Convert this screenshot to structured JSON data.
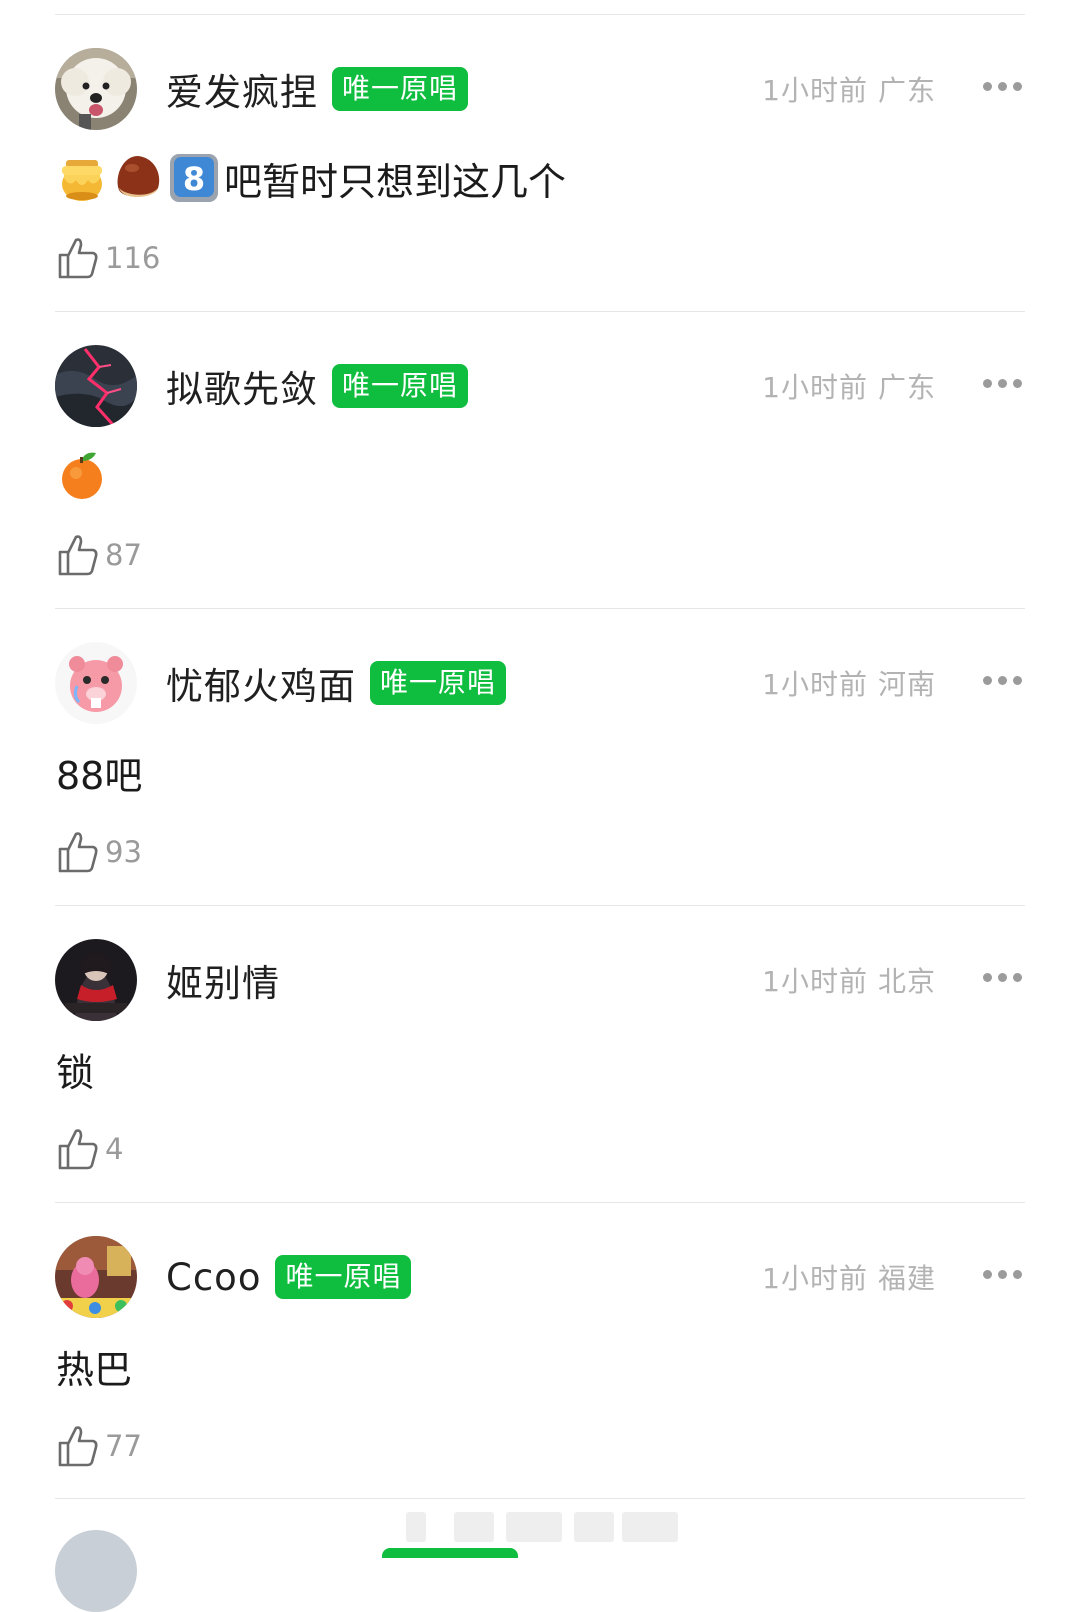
{
  "colors": {
    "badge_bg": "#0fbd3f",
    "meta_text": "#b3b3b3",
    "like_text": "#9a9a9a",
    "divider": "#e6e6e6"
  },
  "comments": [
    {
      "name": "爱发疯捏",
      "badge": "唯一原唱",
      "time": "1小时前",
      "location": "广东",
      "emojis": [
        "honey-pot-emoji",
        "chestnut-emoji",
        "keycap-8-emoji"
      ],
      "text": "吧暂时只想到这几个",
      "likes": "116",
      "avatar": "white-dog-avatar"
    },
    {
      "name": "拟歌先敛",
      "badge": "唯一原唱",
      "time": "1小时前",
      "location": "广东",
      "emojis": [
        "tangerine-emoji"
      ],
      "text": "",
      "likes": "87",
      "avatar": "dark-lightning-avatar"
    },
    {
      "name": "忧郁火鸡面",
      "badge": "唯一原唱",
      "time": "1小时前",
      "location": "河南",
      "emojis": [],
      "text": "88吧",
      "likes": "93",
      "avatar": "pink-beaver-avatar"
    },
    {
      "name": "姬别情",
      "badge": "",
      "time": "1小时前",
      "location": "北京",
      "emojis": [],
      "text": "锁",
      "likes": "4",
      "avatar": "red-scarf-character-avatar"
    },
    {
      "name": "Ccoo",
      "badge": "唯一原唱",
      "time": "1小时前",
      "location": "福建",
      "emojis": [],
      "text": "热巴",
      "likes": "77",
      "avatar": "colorful-room-avatar"
    }
  ]
}
